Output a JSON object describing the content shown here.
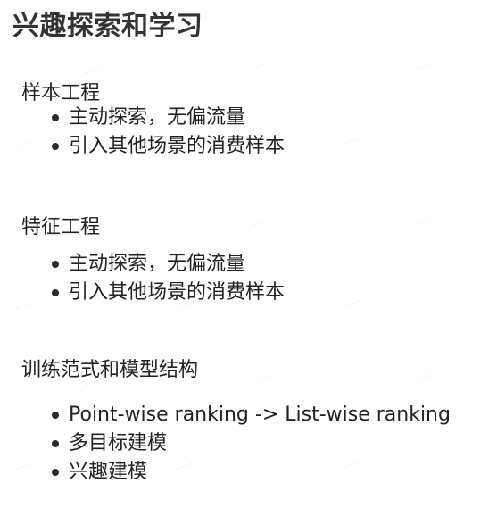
{
  "title": "兴趣探索和学习",
  "sections": [
    {
      "heading": "样本工程",
      "items": [
        "主动探索，无偏流量",
        "引入其他场景的消费样本"
      ]
    },
    {
      "heading": "特征工程",
      "items": [
        "主动探索，无偏流量",
        "引入其他场景的消费样本"
      ]
    },
    {
      "heading": "训练范式和模型结构",
      "items": [
        "Point-wise ranking -> List-wise ranking",
        "多目标建模",
        "兴趣建模"
      ]
    }
  ]
}
